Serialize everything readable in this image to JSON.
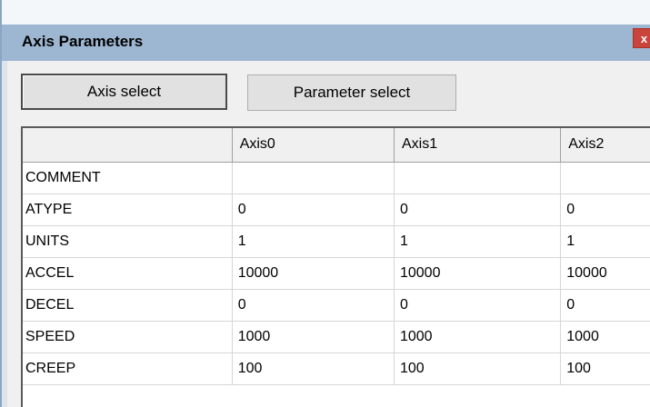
{
  "window": {
    "title": "Axis Parameters",
    "close_label": "x"
  },
  "buttons": {
    "axis_select": "Axis select",
    "parameter_select": "Parameter select"
  },
  "grid": {
    "columns": [
      "",
      "Axis0",
      "Axis1",
      "Axis2"
    ],
    "rows": [
      {
        "name": "COMMENT",
        "values": [
          "",
          "",
          ""
        ]
      },
      {
        "name": "ATYPE",
        "values": [
          "0",
          "0",
          "0"
        ]
      },
      {
        "name": "UNITS",
        "values": [
          "1",
          "1",
          "1"
        ]
      },
      {
        "name": "ACCEL",
        "values": [
          "10000",
          "10000",
          "10000"
        ]
      },
      {
        "name": "DECEL",
        "values": [
          "0",
          "0",
          "0"
        ]
      },
      {
        "name": "SPEED",
        "values": [
          "1000",
          "1000",
          "1000"
        ]
      },
      {
        "name": "CREEP",
        "values": [
          "100",
          "100",
          "100"
        ]
      }
    ]
  },
  "colors": {
    "titlebar": "#9db6d1",
    "close_button": "#c9443b"
  }
}
